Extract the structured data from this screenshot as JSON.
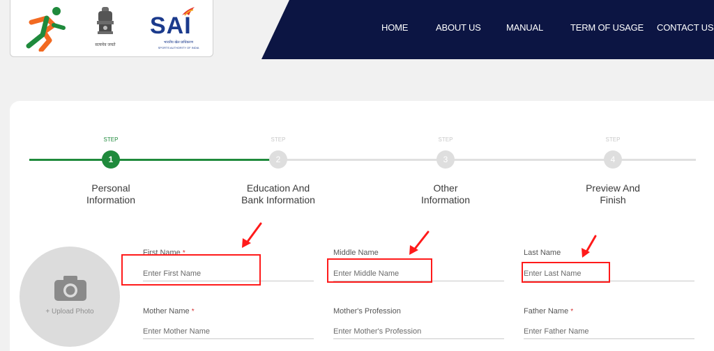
{
  "nav": {
    "items": [
      "HOME",
      "ABOUT US",
      "MANUAL",
      "TERM OF USAGE",
      "CONTACT US"
    ]
  },
  "logos": {
    "emblem_caption": "सत्यमेव जयते",
    "sai_text": "SAI",
    "sai_hindi": "भारतीय खेल प्राधिकरण",
    "sai_english": "SPORTS AUTHORITY OF INDIA"
  },
  "stepper": {
    "steps": [
      {
        "tag": "STEP",
        "number": "1",
        "label_line1": "Personal",
        "label_line2": "Information",
        "active": true
      },
      {
        "tag": "STEP",
        "number": "2",
        "label_line1": "Education And",
        "label_line2": "Bank Information",
        "active": false
      },
      {
        "tag": "STEP",
        "number": "3",
        "label_line1": "Other",
        "label_line2": "Information",
        "active": false
      },
      {
        "tag": "STEP",
        "number": "4",
        "label_line1": "Preview And",
        "label_line2": "Finish",
        "active": false
      }
    ]
  },
  "photo": {
    "label": "+ Upload Photo"
  },
  "form": {
    "first_name": {
      "label": "First Name",
      "required": "*",
      "placeholder": "Enter First Name"
    },
    "middle_name": {
      "label": "Middle Name",
      "placeholder": "Enter Middle Name"
    },
    "last_name": {
      "label": "Last Name",
      "placeholder": "Enter Last Name"
    },
    "mother_name": {
      "label": "Mother Name",
      "required": "*",
      "placeholder": "Enter Mother Name"
    },
    "mother_profession": {
      "label": "Mother's Profession",
      "placeholder": "Enter Mother's Profession"
    },
    "father_name": {
      "label": "Father Name",
      "required": "*",
      "placeholder": "Enter Father Name"
    }
  },
  "colors": {
    "header_bg": "#0c1543",
    "step_active": "#1f8a3c",
    "step_inactive": "#dedede",
    "annotation": "#ff1a1a",
    "required": "#d32f2f",
    "sai_blue": "#1b3a8c"
  }
}
